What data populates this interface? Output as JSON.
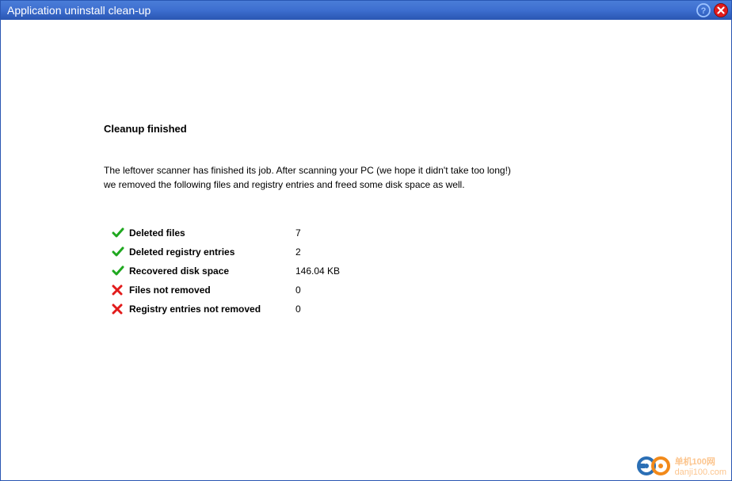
{
  "title": "Application uninstall clean-up",
  "heading": "Cleanup finished",
  "description_line1": "The leftover scanner has finished its job. After scanning your PC (we hope it didn't take too long!)",
  "description_line2": "we removed the following files and registry entries and freed some disk space as well.",
  "results": [
    {
      "status": "ok",
      "label": "Deleted files",
      "value": "7"
    },
    {
      "status": "ok",
      "label": "Deleted registry entries",
      "value": "2"
    },
    {
      "status": "ok",
      "label": "Recovered disk space",
      "value": "146.04 KB"
    },
    {
      "status": "fail",
      "label": "Files not removed",
      "value": "0"
    },
    {
      "status": "fail",
      "label": "Registry entries not removed",
      "value": "0"
    }
  ],
  "watermark_brand": "单机100网",
  "watermark_url": "danji100.com"
}
